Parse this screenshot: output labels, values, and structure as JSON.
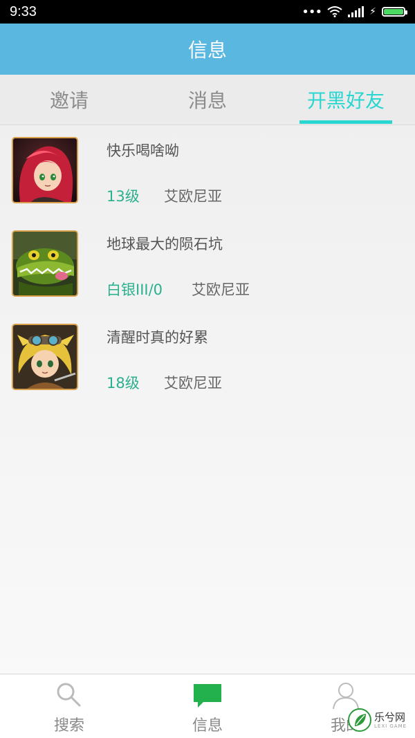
{
  "status_bar": {
    "time": "9:33",
    "battery_level": 1.0,
    "icons": [
      "dots-icon",
      "wifi-icon",
      "signal-icon",
      "charging-icon",
      "battery-icon"
    ]
  },
  "header": {
    "title": "信息",
    "background": "#5ab7df"
  },
  "tabs": [
    {
      "label": "邀请",
      "active": false
    },
    {
      "label": "消息",
      "active": false
    },
    {
      "label": "开黑好友",
      "active": true
    }
  ],
  "accent_color": "#2ad6d0",
  "friends": [
    {
      "name": "快乐喝啥呦",
      "level": "13级",
      "server": "艾欧尼亚",
      "avatar": "red-haired-girl-avatar"
    },
    {
      "name": "地球最大的陨石坑",
      "level": "白银III/0",
      "server": "艾欧尼亚",
      "avatar": "green-crocodile-avatar"
    },
    {
      "name": "清醒时真的好累",
      "level": "18级",
      "server": "艾欧尼亚",
      "avatar": "blonde-boy-goggles-avatar"
    }
  ],
  "bottom_nav": [
    {
      "label": "搜索",
      "icon": "search-icon",
      "active": false
    },
    {
      "label": "信息",
      "icon": "chat-bubble-icon",
      "active": true,
      "icon_color": "#22b14c"
    },
    {
      "label": "我的",
      "icon": "person-icon",
      "active": false
    }
  ],
  "watermark": {
    "text": "乐兮网",
    "subtext": "LEXI GAME"
  }
}
